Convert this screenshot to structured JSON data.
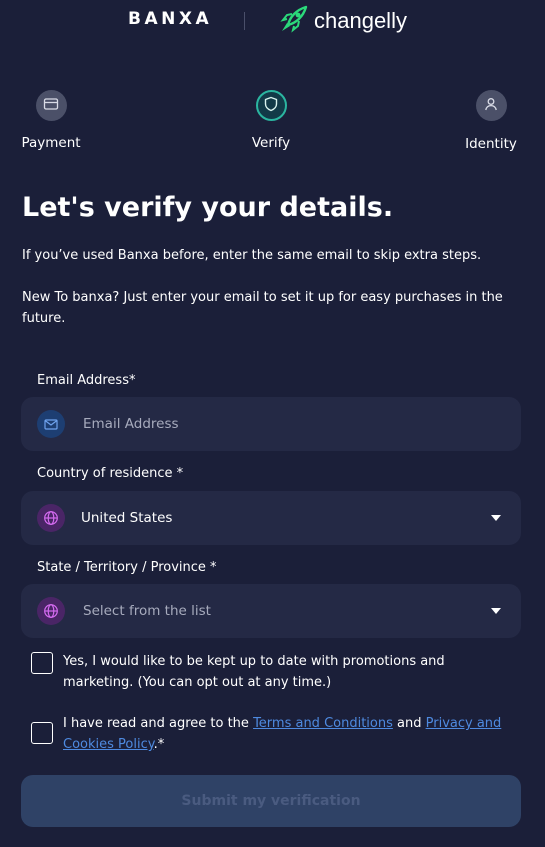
{
  "header": {
    "banxa_logo": "BANXA",
    "changelly_logo": "changelly"
  },
  "steps": [
    {
      "label": "Payment",
      "icon": "card-icon"
    },
    {
      "label": "Verify",
      "icon": "shield-icon"
    },
    {
      "label": "Identity",
      "icon": "user-icon"
    }
  ],
  "title": "Let's verify your details.",
  "intro": {
    "line1": "If you’ve used Banxa before, enter the same email to skip extra steps.",
    "line2": "New To banxa? Just enter your email to set it up for easy purchases in the future."
  },
  "form": {
    "email": {
      "label": "Email Address*",
      "placeholder": "Email Address",
      "value": ""
    },
    "country": {
      "label": "Country of residence *",
      "value": "United States"
    },
    "state": {
      "label": "State / Territory / Province *",
      "placeholder": "Select from the list"
    }
  },
  "checkboxes": {
    "marketing": {
      "text": "Yes, I would like to be kept up to date with promotions and marketing. (You can opt out at any time.)",
      "checked": false
    },
    "terms": {
      "prefix": "I have read and agree to the ",
      "terms_link": "Terms and Conditions",
      "middle": " and ",
      "privacy_link": "Privacy and Cookies Policy",
      "suffix": ".*",
      "checked": false
    }
  },
  "submit_label": "Submit my verification",
  "colors": {
    "background": "#1b1f39",
    "field": "#242945",
    "link": "#4e8ae0",
    "verify_accent": "#2bb5a0",
    "changelly_green": "#2bd97a",
    "submit_disabled": "#2f4266"
  }
}
